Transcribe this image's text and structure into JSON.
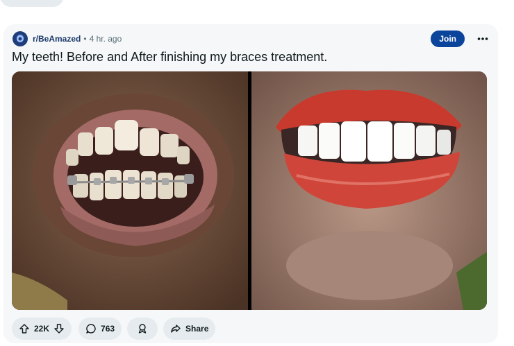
{
  "post": {
    "subreddit": "r/BeAmazed",
    "separator": "•",
    "time": "4 hr. ago",
    "join_label": "Join",
    "title": "My teeth! Before and After finishing my braces treatment."
  },
  "actions": {
    "votes": "22K",
    "comments": "763",
    "share_label": "Share"
  },
  "icons": {
    "avatar": "subreddit-avatar",
    "more": "more-options-icon",
    "upvote": "upvote-arrow-icon",
    "downvote": "downvote-arrow-icon",
    "comment": "comment-bubble-icon",
    "award": "award-icon",
    "share": "share-arrow-icon"
  },
  "colors": {
    "join_button": "#0a449b",
    "card_background": "#f6f7f8",
    "pill_background": "#e5ebee",
    "subreddit_text": "#1c3a6b"
  }
}
